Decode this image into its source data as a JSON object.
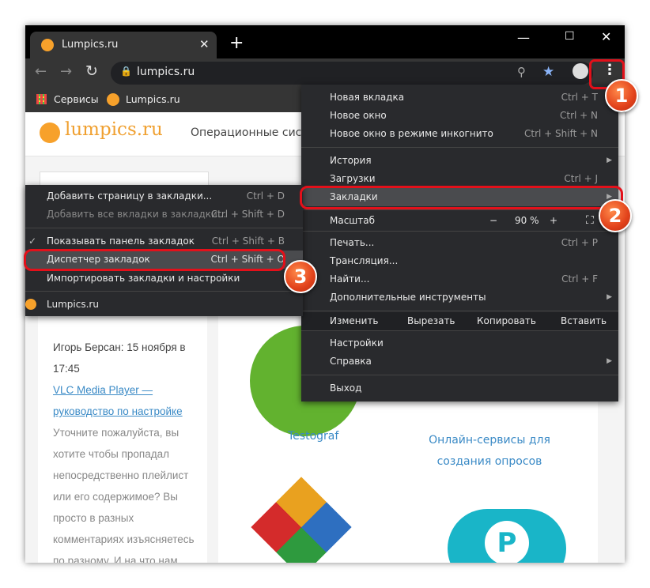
{
  "tab": {
    "title": "Lumpics.ru"
  },
  "omnibox": {
    "url": "lumpics.ru"
  },
  "bookmarks_bar": [
    {
      "label": "Сервисы"
    },
    {
      "label": "Lumpics.ru"
    }
  ],
  "page": {
    "logo": "lumpics.ru",
    "nav": "Операционные сист",
    "comment": {
      "author": "Игорь Берсан: 15 ноября в 17:45",
      "link": "VLC Media Player — руководство по настройке",
      "text": "Уточните пожалуйста, вы хотите чтобы пропадал непосредственно плейлист или его содержимое? Вы просто в разных комментариях изъясняетесь по разному. И на что нам обратить"
    },
    "cards": [
      {
        "label": "Testograf"
      },
      {
        "label": "Онлайн-сервисы для создания опросов"
      }
    ]
  },
  "menu": {
    "items": [
      {
        "label": "Новая вкладка",
        "shortcut": "Ctrl + T"
      },
      {
        "label": "Новое окно",
        "shortcut": "Ctrl + N"
      },
      {
        "label": "Новое окно в режиме инкогнито",
        "shortcut": "Ctrl + Shift + N"
      },
      {
        "label": "История"
      },
      {
        "label": "Загрузки",
        "shortcut": "Ctrl + J"
      },
      {
        "label": "Закладки"
      },
      {
        "label": "Печать...",
        "shortcut": "Ctrl + P"
      },
      {
        "label": "Трансляция..."
      },
      {
        "label": "Найти...",
        "shortcut": "Ctrl + F"
      },
      {
        "label": "Дополнительные инструменты"
      },
      {
        "label": "Настройки"
      },
      {
        "label": "Справка"
      },
      {
        "label": "Выход"
      }
    ],
    "zoom": {
      "label": "Масштаб",
      "minus": "−",
      "value": "90 %",
      "plus": "+"
    },
    "edit": {
      "label": "Изменить",
      "cut": "Вырезать",
      "copy": "Копировать",
      "paste": "Вставить"
    }
  },
  "submenu": {
    "items": [
      {
        "label": "Добавить страницу в закладки...",
        "shortcut": "Ctrl + D"
      },
      {
        "label": "Добавить все вкладки в закладки...",
        "shortcut": "Ctrl + Shift + D"
      },
      {
        "label": "Показывать панель закладок",
        "shortcut": "Ctrl + Shift + B"
      },
      {
        "label": "Диспетчер закладок",
        "shortcut": "Ctrl + Shift + O"
      },
      {
        "label": "Импортировать закладки и настройки"
      },
      {
        "label": "Lumpics.ru"
      }
    ]
  },
  "callouts": [
    "1",
    "2",
    "3"
  ]
}
